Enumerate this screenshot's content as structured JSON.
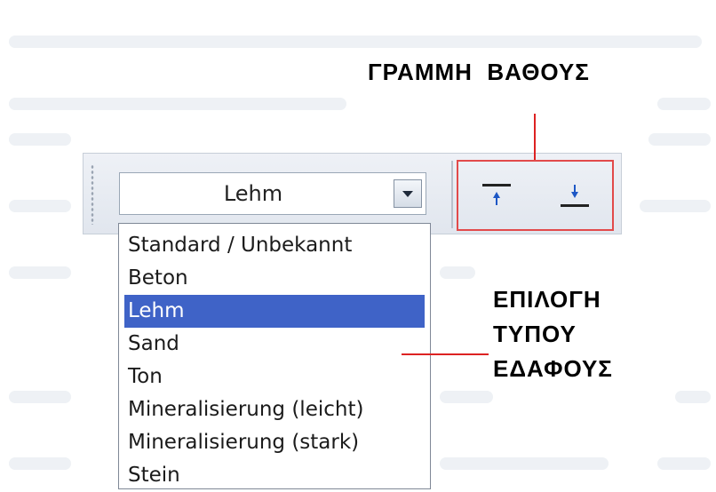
{
  "toolbar": {
    "soil_combo": {
      "value": "Lehm",
      "options": [
        "Standard / Unbekannt",
        "Beton",
        "Lehm",
        "Sand",
        "Ton",
        "Mineralisierung (leicht)",
        "Mineralisierung (stark)",
        "Stein"
      ],
      "selected_index": 2
    },
    "depth_buttons": [
      {
        "icon": "depth-line-up-icon"
      },
      {
        "icon": "depth-line-down-icon"
      }
    ]
  },
  "annotations": {
    "depth_line": "ΓΡΑΜΜΗ  ΒΑΘΟΥΣ",
    "soil_type_line1": "ΕΠΙΛΟΓΗ",
    "soil_type_line2": "ΤΥΠΟΥ",
    "soil_type_line3": "ΕΔΑΦΟΥΣ"
  },
  "colors": {
    "annotation_line": "#dd2222",
    "selected_item": "#3f63c7"
  }
}
